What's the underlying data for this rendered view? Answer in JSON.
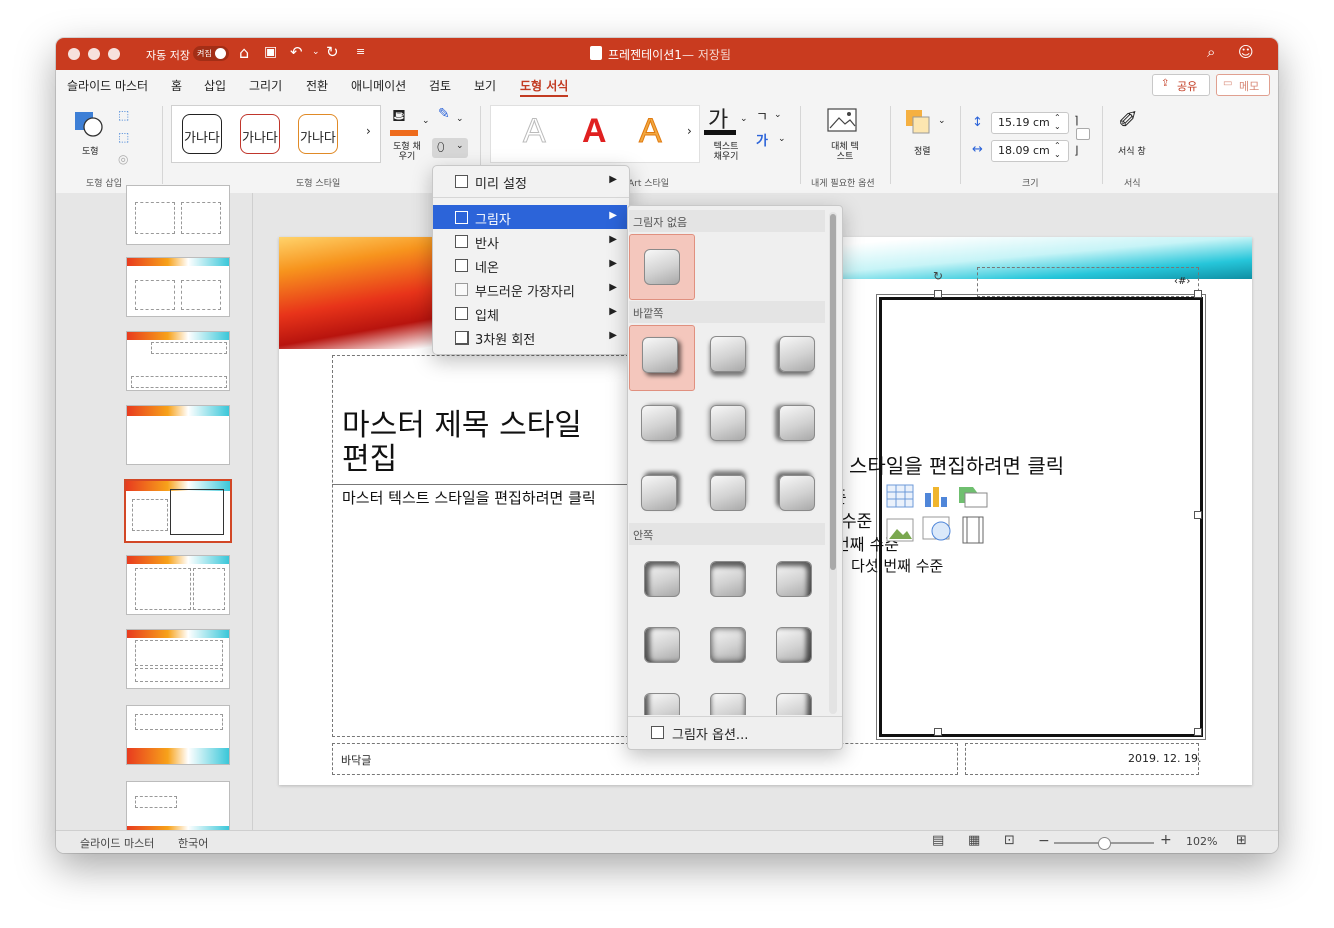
{
  "window": {
    "autosave_label": "자동 저장",
    "autosave_toggle": "켜짐",
    "title": "프레젠테이션1",
    "title_status": "— 저장됨"
  },
  "tabs": [
    {
      "label": "슬라이드 마스터"
    },
    {
      "label": "홈"
    },
    {
      "label": "삽입"
    },
    {
      "label": "그리기"
    },
    {
      "label": "전환"
    },
    {
      "label": "애니메이션"
    },
    {
      "label": "검토"
    },
    {
      "label": "보기"
    },
    {
      "label": "도형 서식"
    }
  ],
  "header_buttons": {
    "share": "공유",
    "comment": "메모"
  },
  "ribbon": {
    "insert_shapes": {
      "shape_label": "도형",
      "group_label": "도형 삽입"
    },
    "shape_styles": {
      "gallery": [
        "가나다",
        "가나다",
        "가나다"
      ],
      "fill_label": "도형 채우기",
      "group_label": "도형 스타일"
    },
    "wordart": {
      "fill_label": "텍스트 채우기",
      "text_glyph": "가",
      "group_label": "WordArt 스타일",
      "group_label_visible": "Art 스타일"
    },
    "accessibility": {
      "alt_text_label": "대체 텍스트",
      "group_label": "내게 필요한 옵션"
    },
    "arrange": {
      "label": "정렬"
    },
    "size": {
      "height": "15.19 cm",
      "width": "18.09 cm",
      "group_label": "크기"
    },
    "format_pane": {
      "label": "서식 창",
      "group_label": "서식"
    }
  },
  "menu_effects": {
    "items": [
      {
        "label": "미리 설정"
      },
      {
        "label": "그림자"
      },
      {
        "label": "반사"
      },
      {
        "label": "네온"
      },
      {
        "label": "부드러운 가장자리"
      },
      {
        "label": "입체"
      },
      {
        "label": "3차원 회전"
      }
    ]
  },
  "menu_shadow": {
    "section_none": "그림자 없음",
    "section_outer": "바깥쪽",
    "section_inner": "안쪽",
    "options_label": "그림자 옵션..."
  },
  "slide": {
    "title_line1": "마스터 제목 스타일",
    "title_line2": "편집",
    "body_left": "마스터 텍스트 스타일을 편집하려면 클릭",
    "right_line1": "스타일을 편집하려면 클릭",
    "right_line2": "준",
    "right_line3": "수준",
    "right_line4": "번째 수준",
    "right_line5": "다섯 번째 수준",
    "page_num": "‹#›",
    "footer": "바닥글",
    "date": "2019. 12. 19."
  },
  "status": {
    "view": "슬라이드 마스터",
    "language": "한국어",
    "zoom": "102%",
    "zoom_fraction": 0.5
  },
  "colors": {
    "accent": "#c93b1f",
    "tab_active": "#c23b22",
    "menu_highlight": "#2c64d9",
    "selection": "#d24726"
  }
}
